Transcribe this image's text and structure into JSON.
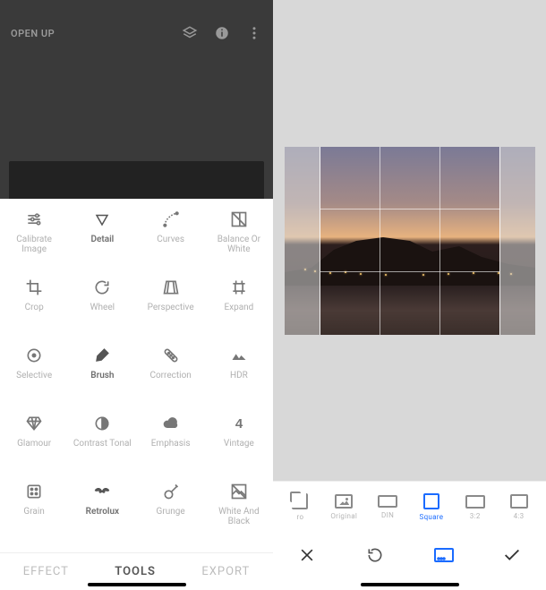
{
  "left": {
    "title": "OPEN UP",
    "tabs": {
      "effect": "EFFECT",
      "tools": "TOOLS",
      "export": "EXPORT"
    },
    "tools": [
      {
        "name": "calibrate-image",
        "label": "Calibrate Image",
        "icon": "sliders"
      },
      {
        "name": "detail",
        "label": "Detail",
        "icon": "triangle-down",
        "emph": true
      },
      {
        "name": "curves",
        "label": "Curves",
        "icon": "curve"
      },
      {
        "name": "balance-white",
        "label": "Balance Or White",
        "icon": "balance"
      },
      {
        "name": "crop",
        "label": "Crop",
        "icon": "crop"
      },
      {
        "name": "wheel",
        "label": "Wheel",
        "icon": "rotate"
      },
      {
        "name": "perspective",
        "label": "Perspective",
        "icon": "perspective"
      },
      {
        "name": "expand",
        "label": "Expand",
        "icon": "expand"
      },
      {
        "name": "selective",
        "label": "Selective",
        "icon": "target"
      },
      {
        "name": "brush",
        "label": "Brush",
        "icon": "brush",
        "emph": true
      },
      {
        "name": "correction",
        "label": "Correction",
        "icon": "bandage"
      },
      {
        "name": "hdr",
        "label": "HDR",
        "icon": "mountains"
      },
      {
        "name": "glamour",
        "label": "Glamour",
        "icon": "diamond"
      },
      {
        "name": "contrast-tonal",
        "label": "Contrast Tonal",
        "icon": "half-circle"
      },
      {
        "name": "emphasis",
        "label": "Emphasis",
        "icon": "cloud"
      },
      {
        "name": "vintage",
        "label": "Vintage",
        "icon": "number-four"
      },
      {
        "name": "grain",
        "label": "Grain",
        "icon": "dice"
      },
      {
        "name": "retrolux",
        "label": "Retrolux",
        "icon": "mustache",
        "emph": true
      },
      {
        "name": "grunge",
        "label": "Grunge",
        "icon": "guitar"
      },
      {
        "name": "white-black",
        "label": "White And Black",
        "icon": "image-bw"
      }
    ]
  },
  "right": {
    "aspects": [
      {
        "name": "free",
        "label": "ro",
        "w": 18,
        "h": 18,
        "kind": "free"
      },
      {
        "name": "original",
        "label": "Original",
        "w": 20,
        "h": 16,
        "kind": "image"
      },
      {
        "name": "din",
        "label": "DIN",
        "w": 22,
        "h": 14
      },
      {
        "name": "square",
        "label": "Square",
        "w": 18,
        "h": 18,
        "selected": true
      },
      {
        "name": "3-2",
        "label": "3:2",
        "w": 22,
        "h": 15
      },
      {
        "name": "4-3",
        "label": "4:3",
        "w": 20,
        "h": 16
      }
    ],
    "actions": {
      "cancel": "cancel",
      "rotate": "rotate",
      "aspect": "aspect-toggle",
      "confirm": "confirm"
    }
  }
}
